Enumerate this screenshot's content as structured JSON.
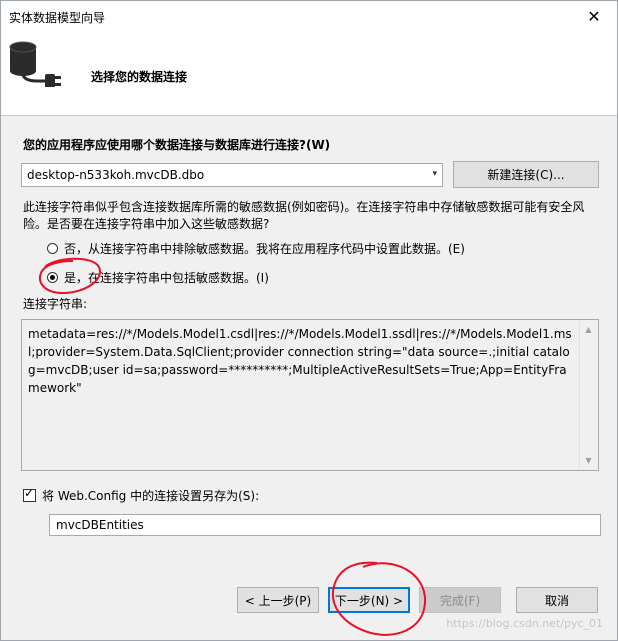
{
  "window": {
    "title": "实体数据模型向导",
    "close_glyph": "✕"
  },
  "header": {
    "title": "选择您的数据连接",
    "icon": "database-plug-icon"
  },
  "question": "您的应用程序应使用哪个数据连接与数据库进行连接?(W)",
  "connection_select": {
    "value": "desktop-n533koh.mvcDB.dbo",
    "arrow_glyph": "▾"
  },
  "new_connection_label": "新建连接(C)...",
  "warning_text": "此连接字符串似乎包含连接数据库所需的敏感数据(例如密码)。在连接字符串中存储敏感数据可能有安全风险。是否要在连接字符串中加入这些敏感数据?",
  "radio_options": [
    {
      "label": "否，从连接字符串中排除敏感数据。我将在应用程序代码中设置此数据。(E)",
      "checked": false
    },
    {
      "label": "是，在连接字符串中包括敏感数据。(I)",
      "checked": true
    }
  ],
  "connection_string_label": "连接字符串:",
  "connection_string": "metadata=res://*/Models.Model1.csdl|res://*/Models.Model1.ssdl|res://*/Models.Model1.msl;provider=System.Data.SqlClient;provider connection string=\"data source=.;initial catalog=mvcDB;user id=sa;password=**********;MultipleActiveResultSets=True;App=EntityFramework\"",
  "save_config": {
    "checked": true,
    "label": "将 Web.Config 中的连接设置另存为(S):",
    "check_glyph": "✓"
  },
  "entity_name": "mvcDBEntities",
  "buttons": {
    "prev": "< 上一步(P)",
    "next": "下一步(N) >",
    "finish": "完成(F)",
    "cancel": "取消"
  },
  "watermark": "https://blog.csdn.net/pyc_01",
  "colors": {
    "annotation_red": "#e8102a",
    "focus_blue": "#0078d7"
  }
}
